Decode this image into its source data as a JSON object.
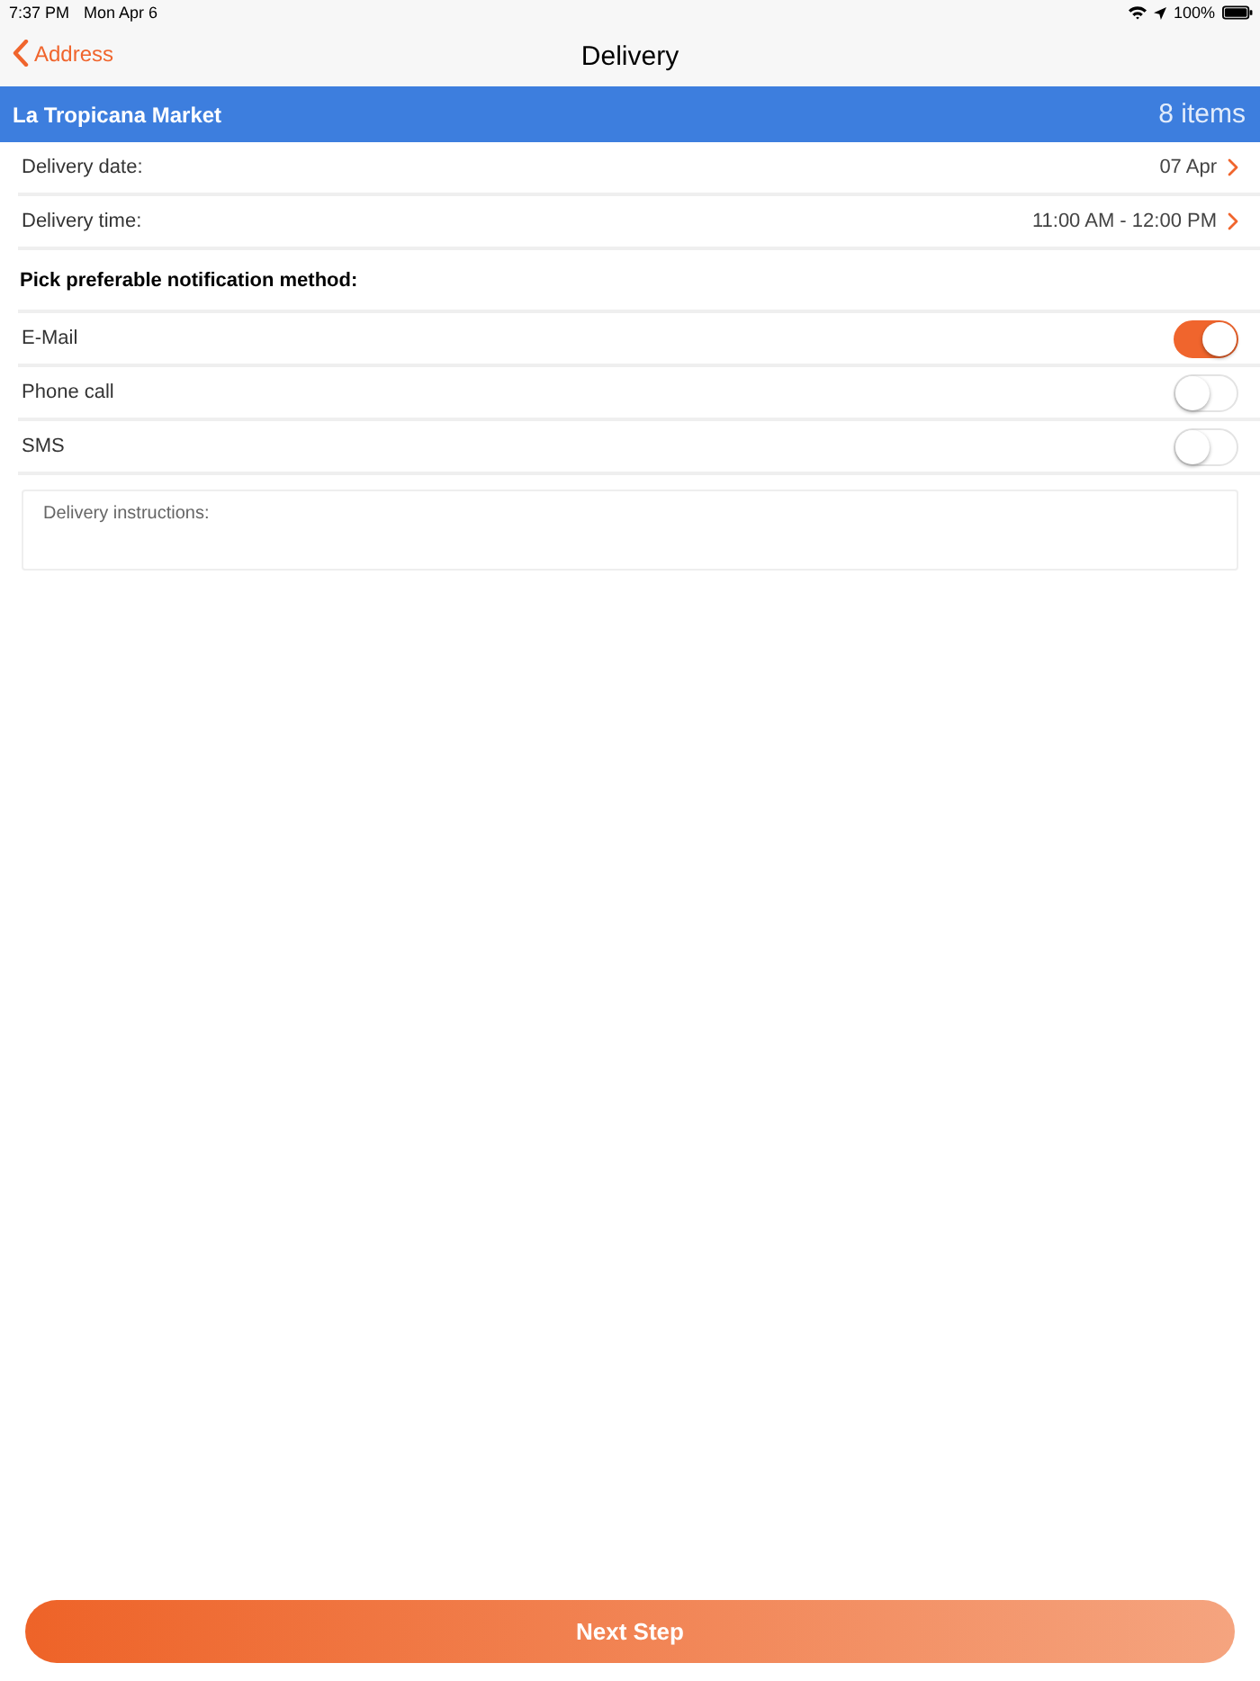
{
  "status_bar": {
    "time": "7:37 PM",
    "date": "Mon Apr 6",
    "battery": "100%"
  },
  "nav_bar": {
    "back": "Address",
    "title": "Delivery"
  },
  "store_header": {
    "name": "La Tropicana Market",
    "count": "8 items"
  },
  "details": [
    {
      "label": "Delivery date:",
      "value": "07 Apr"
    },
    {
      "label": "Delivery time:",
      "value": "11:00 AM - 12:00 PM"
    }
  ],
  "notification": {
    "heading": "Pick preferable notification method:",
    "methods": [
      {
        "label": "E-Mail",
        "on": true
      },
      {
        "label": "Phone call",
        "on": false
      },
      {
        "label": "SMS",
        "on": false
      }
    ]
  },
  "instructions": {
    "placeholder": "Delivery instructions:"
  },
  "next_button": {
    "label": "Next Step"
  }
}
